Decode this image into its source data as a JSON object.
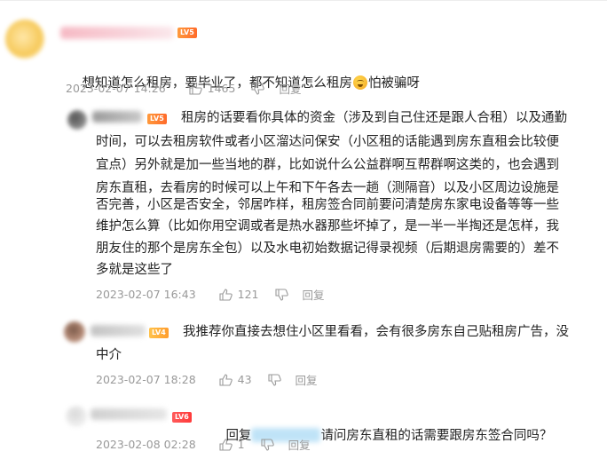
{
  "comments": [
    {
      "text": "想知道怎么租房，要毕业了，都不知道怎么租房",
      "text_after_emoji": "怕被骗呀",
      "emoji": "face-emoji-icon",
      "date": "2023-02-07 14:26",
      "likes": "1465",
      "reply_label": "回复",
      "level_badge": "LV5"
    },
    {
      "lines": [
        "租房的话要看你具体的资金（涉及到自己住还是跟人合租）以及通勤",
        "时间，可以去租房软件或者小区溜达问保安（小区租的话能遇到房东直租会比较便",
        "宜点）另外就是加一些当地的群，比如说什么公益群啊互帮群啊这类的，也会遇到",
        "房东直租，去看房的时候可以上午和下午各去一趟（测隔音）以及小区周边设施是",
        "否完善，小区是否安全，邻居咋样，租房签合同前要问清楚房东家电设备等等一些",
        "维护怎么算（比如你用空调或者是热水器那些坏掉了，是一半一半掏还是怎样，我",
        "朋友住的那个是房东全包）以及水电初始数据记得录视频（后期退房需要的）差不",
        "多就是这些了"
      ],
      "date": "2023-02-07 16:43",
      "likes": "121",
      "reply_label": "回复",
      "level_badge": "LV5"
    },
    {
      "lines": [
        "我推荐你直接去想住小区里看看，会有很多房东自己贴租房广告，没",
        "中介"
      ],
      "date": "2023-02-07 18:28",
      "likes": "43",
      "reply_label": "回复",
      "level_badge": "LV4"
    },
    {
      "reply_prefix": "回复",
      "text": "请问房东直租的话需要跟房东签合同吗？",
      "date": "2023-02-08 02:28",
      "likes": "1",
      "reply_label": "回复",
      "level_badge": "LV6"
    }
  ],
  "colors": {
    "meta_gray": "#999999",
    "text": "#222222",
    "mention_blue": "#bfe3f7"
  }
}
